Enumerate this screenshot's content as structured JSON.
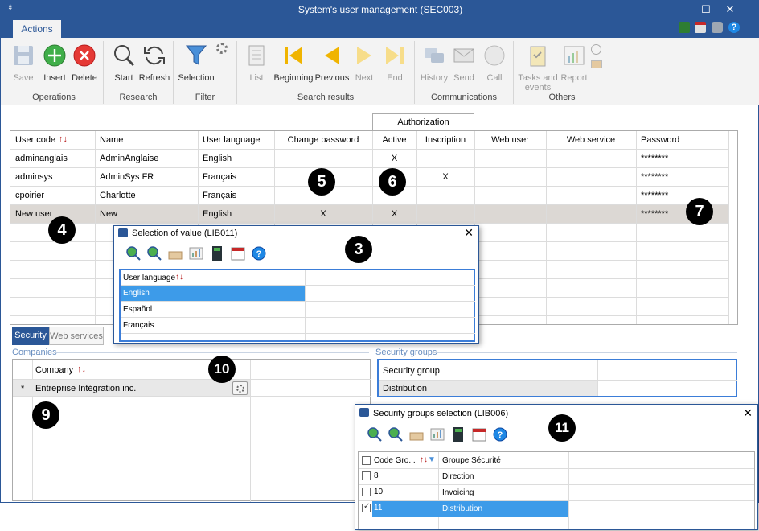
{
  "window": {
    "title": "System's user management (SEC003)",
    "minimize": "—",
    "maximize": "☐",
    "close": "✕"
  },
  "ribbon": {
    "tab": "Actions",
    "buttons": {
      "save": "Save",
      "insert": "Insert",
      "delete": "Delete",
      "start": "Start",
      "refresh": "Refresh",
      "selection": "Selection",
      "list": "List",
      "beginning": "Beginning",
      "previous": "Previous",
      "next": "Next",
      "end": "End",
      "history": "History",
      "send": "Send",
      "call": "Call",
      "tasks": "Tasks and events",
      "report": "Report"
    },
    "groups": {
      "operations": "Operations",
      "research": "Research",
      "filter": "Filter",
      "search_results": "Search results",
      "communications": "Communications",
      "others": "Others"
    }
  },
  "grid": {
    "group_header": "Authorization",
    "columns": {
      "user_code": "User code",
      "name": "Name",
      "user_language": "User language",
      "change_password": "Change password",
      "active": "Active",
      "inscription": "Inscription",
      "web_user": "Web user",
      "web_service": "Web service",
      "password": "Password"
    },
    "rows": [
      {
        "code": "adminanglais",
        "name": "AdminAnglaise",
        "lang": "English",
        "change": "",
        "active": "X",
        "insc": "",
        "pwd": "********"
      },
      {
        "code": "adminsys",
        "name": "AdminSys FR",
        "lang": "Français",
        "change": "",
        "active": "",
        "insc": "X",
        "pwd": "********"
      },
      {
        "code": "cpoirier",
        "name": "Charlotte",
        "lang": "Français",
        "change": "",
        "active": "",
        "insc": "",
        "pwd": "********"
      },
      {
        "code": "New user",
        "name": "New",
        "lang": "English",
        "change": "X",
        "active": "X",
        "insc": "",
        "pwd": "********"
      }
    ]
  },
  "tabs": {
    "security": "Security",
    "web_services": "Web services"
  },
  "companies": {
    "legend": "Companies",
    "col": "Company",
    "row_marker": "*",
    "row": "Entreprise Intégration inc."
  },
  "security_groups": {
    "legend": "Security groups",
    "col": "Security group",
    "row": "Distribution"
  },
  "lib011": {
    "title": "Selection of value (LIB011)",
    "col": "User language",
    "options": [
      "English",
      "Español",
      "Français"
    ]
  },
  "lib006": {
    "title": "Security groups selection (LIB006)",
    "col_code": "Code Gro...",
    "col_group": "Groupe Sécurité",
    "rows": [
      {
        "code": "8",
        "name": "Direction",
        "checked": false
      },
      {
        "code": "10",
        "name": "Invoicing",
        "checked": false
      },
      {
        "code": "11",
        "name": "Distribution",
        "checked": true
      }
    ]
  },
  "callouts": {
    "c3": "3",
    "c4": "4",
    "c5": "5",
    "c6": "6",
    "c7": "7",
    "c9": "9",
    "c10": "10",
    "c11": "11"
  }
}
